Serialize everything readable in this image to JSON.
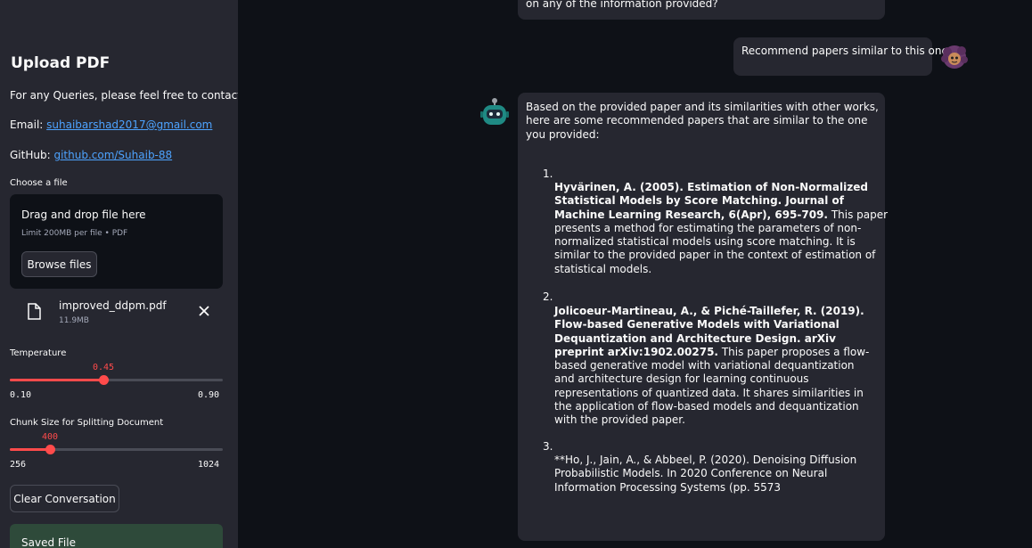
{
  "sidebar": {
    "title": "Upload PDF",
    "contact_text": "For any Queries, please feel free to contact",
    "email_label": "Email: ",
    "email": "suhaibarshad2017@gmail.com",
    "github_label": "GitHub: ",
    "github": "github.com/Suhaib-88",
    "uploader": {
      "label": "Choose a file",
      "drop_text": "Drag and drop file here",
      "limit_text": "Limit 200MB per file • PDF",
      "browse_label": "Browse files"
    },
    "file": {
      "name": "improved_ddpm.pdf",
      "size": "11.9MB",
      "icon": "document-icon"
    },
    "temperature": {
      "label": "Temperature",
      "value": "0.45",
      "min": "0.10",
      "max": "0.90",
      "fraction": 0.4375
    },
    "chunk_size": {
      "label": "Chunk Size for Splitting Document",
      "value": "400",
      "min": "256",
      "max": "1024",
      "fraction": 0.1875
    },
    "clear_label": "Clear Conversation",
    "saved_label": "Saved File"
  },
  "chat": {
    "prev_message_tail": "on any of the information provided?",
    "user_message": "Recommend papers similar to this one",
    "bot_intro": "Based on the provided paper and its similarities with other works, here are some recommended papers that are similar to the one you provided:",
    "recommendations": [
      {
        "num": "1.",
        "bold": "Hyvärinen, A. (2005). Estimation of Non-Normalized Statistical Models by Score Matching. Journal of Machine Learning Research, 6(Apr), 695-709.",
        "text": " This paper presents a method for estimating the parameters of non-normalized statistical models using score matching. It is similar to the provided paper in the context of estimation of statistical models."
      },
      {
        "num": "2.",
        "bold": "Jolicoeur-Martineau, A., & Piché-Taillefer, R. (2019). Flow-based Generative Models with Variational Dequantization and Architecture Design. arXiv preprint arXiv:1902.00275.",
        "text": " This paper proposes a flow-based generative model with variational dequantization and architecture design for learning continuous representations of quantized data. It shares similarities in the application of flow-based models and dequantization with the provided paper."
      },
      {
        "num": "3.",
        "bold": "",
        "text": "**Ho, J., Jain, A., & Abbeel, P. (2020). Denoising Diffusion Probabilistic Models. In 2020 Conference on Neural Information Processing Systems (pp. 5573"
      }
    ]
  },
  "colors": {
    "accent": "#ff4b4b",
    "link": "#4da3ff",
    "sidebar_bg": "#262730",
    "main_bg": "#0e1117"
  }
}
